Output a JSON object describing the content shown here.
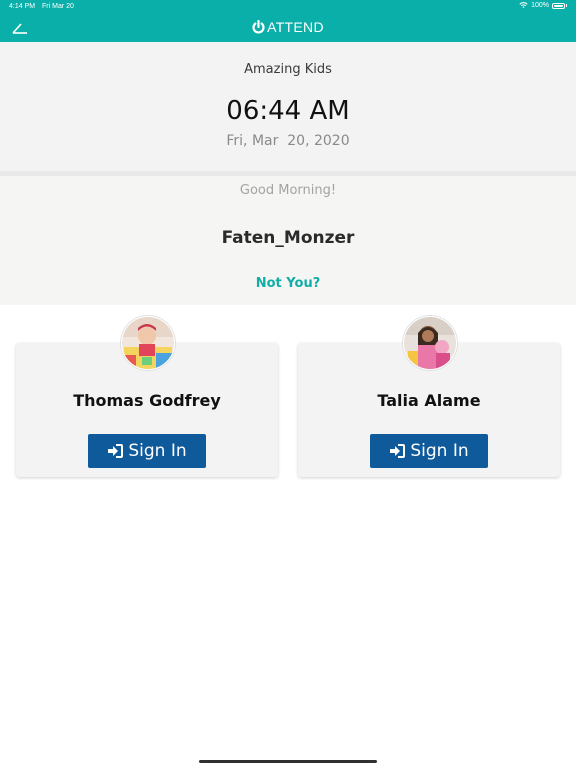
{
  "status_bar": {
    "time": "4:14 PM",
    "date": "Fri Mar 20",
    "battery": "100%",
    "icons": [
      "wifi-icon",
      "battery-icon"
    ]
  },
  "nav_bar": {
    "brand": "ATTEND",
    "brand_icon": "power-icon",
    "back_icon": "back-icon",
    "color": "#0bafa9"
  },
  "header": {
    "school_name": "Amazing Kids",
    "time": "06:44 AM",
    "date": "Fri, Mar  20, 2020"
  },
  "user": {
    "greeting": "Good Morning!",
    "name": "Faten_Monzer",
    "not_you_label": "Not You?"
  },
  "children": [
    {
      "name": "Thomas Godfrey",
      "button_label": "Sign In",
      "button_icon": "sign-in-icon"
    },
    {
      "name": "Talia Alame",
      "button_label": "Sign In",
      "button_icon": "sign-in-icon"
    }
  ],
  "colors": {
    "accent": "#0bafa9",
    "button": "#0f5a9b",
    "link": "#12ada6"
  }
}
